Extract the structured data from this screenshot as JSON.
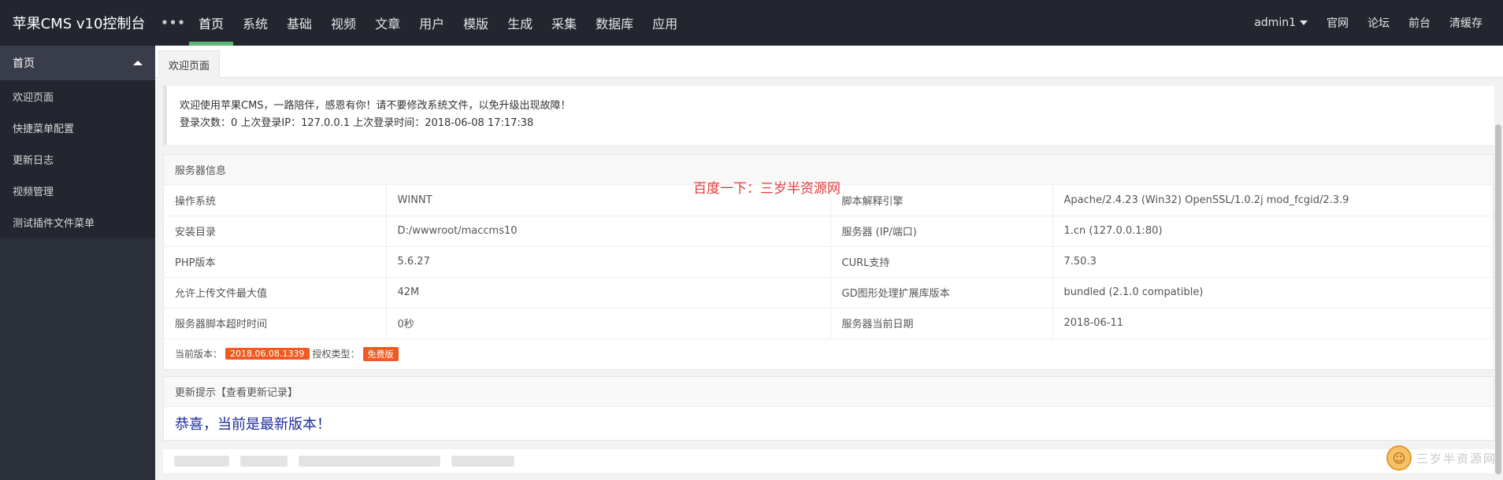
{
  "topbar": {
    "brand": "苹果CMS v10控制台",
    "more": "•••",
    "nav": [
      "首页",
      "系统",
      "基础",
      "视频",
      "文章",
      "用户",
      "模版",
      "生成",
      "采集",
      "数据库",
      "应用"
    ],
    "active_index": 0,
    "user": "admin1",
    "links": [
      "官网",
      "论坛",
      "前台",
      "清缓存"
    ]
  },
  "sidebar": {
    "section": "首页",
    "items": [
      "欢迎页面",
      "快捷菜单配置",
      "更新日志",
      "视频管理",
      "测试插件文件菜单"
    ]
  },
  "tabs": [
    "欢迎页面"
  ],
  "welcome": {
    "line1": "欢迎使用苹果CMS，一路陪伴，感恩有你！请不要修改系统文件，以免升级出现故障！",
    "line2": "登录次数：0 上次登录IP：127.0.0.1 上次登录时间：2018-06-08 17:17:38"
  },
  "server": {
    "title": "服务器信息",
    "rows": [
      [
        "操作系统",
        "WINNT",
        "脚本解释引擎",
        "Apache/2.4.23 (Win32) OpenSSL/1.0.2j mod_fcgid/2.3.9"
      ],
      [
        "安装目录",
        "D:/wwwroot/maccms10",
        "服务器 (IP/端口)",
        "1.cn (127.0.0.1:80)"
      ],
      [
        "PHP版本",
        "5.6.27",
        "CURL支持",
        "7.50.3"
      ],
      [
        "允许上传文件最大值",
        "42M",
        "GD图形处理扩展库版本",
        "bundled (2.1.0 compatible)"
      ],
      [
        "服务器脚本超时时间",
        "0秒",
        "服务器当前日期",
        "2018-06-11"
      ]
    ],
    "version_label": "当前版本：",
    "version": "2018.06.08.1339",
    "license_label": "授权类型：",
    "license": "免费版"
  },
  "update": {
    "title": "更新提示【查看更新记录】",
    "message": "恭喜，当前是最新版本！"
  },
  "watermark": "百度一下：三岁半资源网",
  "logo_text": "三岁半资源网",
  "colors": {
    "nav_bg": "#23262e",
    "active_underline": "#5fb878",
    "badge": "#f15a22",
    "congrats": "#1e2b9a",
    "watermark": "#e4393c"
  }
}
